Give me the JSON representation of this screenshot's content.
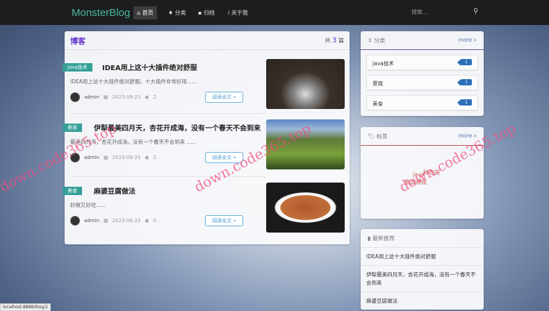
{
  "nav": {
    "logo": "MonsterBlog",
    "items": [
      {
        "icon": "home-icon",
        "label": "首页"
      },
      {
        "icon": "lightbulb-icon",
        "label": "分类"
      },
      {
        "icon": "archive-icon",
        "label": "归档"
      },
      {
        "icon": "info-icon",
        "label": "关于我"
      }
    ],
    "search_placeholder": "搜索..."
  },
  "main": {
    "title": "博客",
    "count_prefix": "共",
    "count": "3",
    "count_suffix": "篇",
    "posts": [
      {
        "tag": "java技术",
        "title": "IDEA用上这十大插件绝对舒服",
        "desc": "IDEA用上这十大插件绝对舒服。十大插件非常好用......",
        "author": "admin",
        "date": "2023-09-23",
        "views": "2",
        "read": "阅读全文 »"
      },
      {
        "tag": "景观",
        "title": "伊犁最美四月天，杏花开成海，没有一个春天不会到来",
        "desc": "最美四月天，杏花开成海，没有一个春天不会到来 ......",
        "author": "admin",
        "date": "2023-09-23",
        "views": "2",
        "read": "阅读全文 »"
      },
      {
        "tag": "美食",
        "title": "麻婆豆腐做法",
        "desc": "好做又好吃......",
        "author": "admin",
        "date": "2023-09-23",
        "views": "0",
        "read": "阅读全文 »"
      }
    ]
  },
  "categories": {
    "title": "分类",
    "more": "more »",
    "items": [
      {
        "name": "java技术",
        "count": "1"
      },
      {
        "name": "景观",
        "count": "1"
      },
      {
        "name": "美食",
        "count": "1"
      }
    ]
  },
  "tags": {
    "title": "标签",
    "more": "more »",
    "items": [
      "java",
      "好吃的",
      "旅游景观"
    ]
  },
  "recommend": {
    "title": "最新推荐",
    "items": [
      "IDEA用上这十大插件绝对舒服",
      "伊犁最美四月天，杏花开成海，没有一个春天不会到来",
      "麻婆豆腐做法"
    ]
  },
  "watermark": "down.code365.top",
  "status_url": "localhost:8888/blog/1",
  "colors": {
    "accent": "#6435c9",
    "teal": "#35a097",
    "badge": "#2c6fb8"
  }
}
